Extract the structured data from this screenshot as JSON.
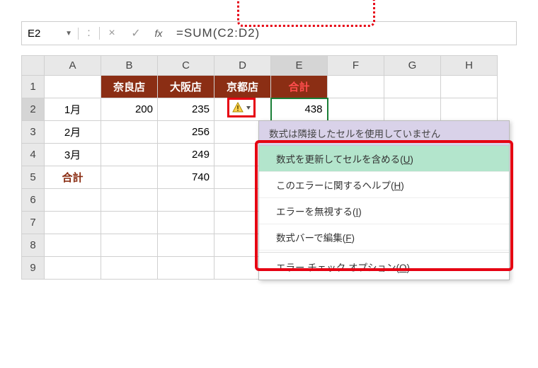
{
  "namebox": {
    "value": "E2"
  },
  "formula_bar": {
    "formula": "=SUM(C2:D2)",
    "fx_label": "fx",
    "ell": ":"
  },
  "columns": [
    "A",
    "B",
    "C",
    "D",
    "E",
    "F",
    "G",
    "H"
  ],
  "rows": [
    "1",
    "2",
    "3",
    "4",
    "5",
    "6",
    "7",
    "8",
    "9"
  ],
  "header_row": {
    "B": "奈良店",
    "C": "大阪店",
    "D": "京都店",
    "E": "合計"
  },
  "data": {
    "r2": {
      "A": "1月",
      "B": "200",
      "C": "235",
      "E": "438"
    },
    "r3": {
      "A": "2月",
      "C": "256"
    },
    "r4": {
      "A": "3月",
      "C": "249"
    },
    "r5": {
      "A": "合計",
      "C": "740"
    }
  },
  "menu": {
    "header": "数式は隣接したセルを使用していません",
    "items": [
      {
        "label": "数式を更新してセルを含める",
        "accel": "U",
        "highlight": true
      },
      {
        "label": "このエラーに関するヘルプ",
        "accel": "H"
      },
      {
        "label": "エラーを無視する",
        "accel": "I"
      },
      {
        "label": "数式バーで編集",
        "accel": "F"
      },
      {
        "label": "エラー チェック オプション",
        "accel": "O",
        "trail": "..."
      }
    ]
  },
  "colors": {
    "brown": "#8b2e14",
    "red": "#e60012",
    "hl": "#b3e5cc"
  }
}
